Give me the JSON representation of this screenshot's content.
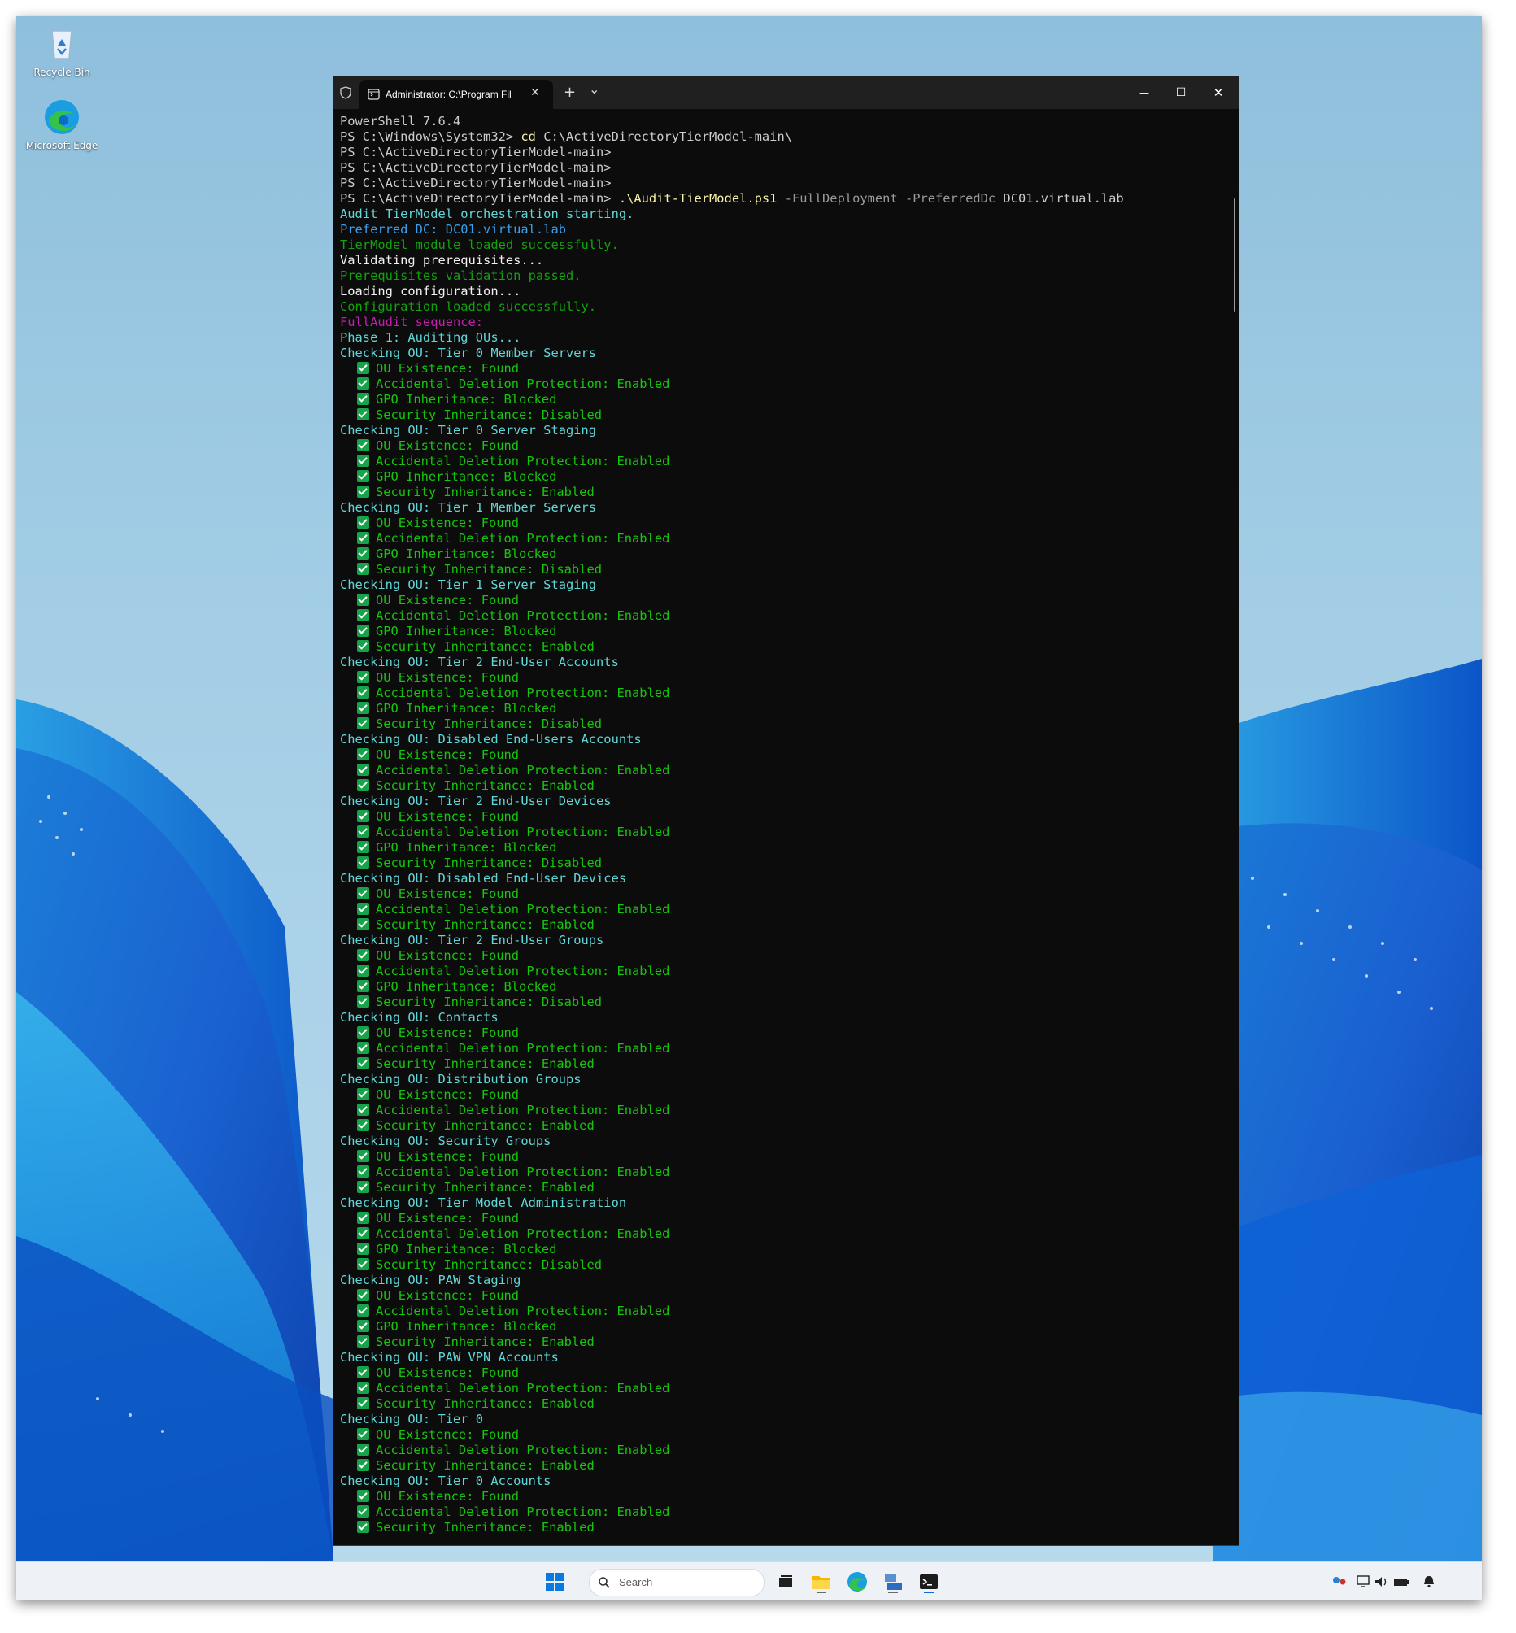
{
  "desktop": {
    "icons": [
      {
        "label": "Recycle Bin",
        "icon": "recycle-bin-icon"
      },
      {
        "label": "Microsoft Edge",
        "icon": "edge-icon"
      }
    ]
  },
  "terminal": {
    "tab_title": "Administrator: C:\\Program Fil",
    "new_tab_symbol": "+",
    "dropdown_symbol": "⌄",
    "minimize_symbol": "—",
    "maximize_symbol": "☐",
    "close_symbol": "✕",
    "header_lines": [
      {
        "segments": [
          {
            "text": "PowerShell 7.6.4",
            "color": "white"
          }
        ]
      },
      {
        "segments": [
          {
            "text": "PS C:\\Windows\\System32> ",
            "color": "white"
          },
          {
            "text": "cd",
            "color": "yellow"
          },
          {
            "text": " C:\\ActiveDirectoryTierModel-main\\",
            "color": "white"
          }
        ]
      },
      {
        "segments": [
          {
            "text": "PS C:\\ActiveDirectoryTierModel-main>",
            "color": "white"
          }
        ]
      },
      {
        "segments": [
          {
            "text": "PS C:\\ActiveDirectoryTierModel-main>",
            "color": "white"
          }
        ]
      },
      {
        "segments": [
          {
            "text": "PS C:\\ActiveDirectoryTierModel-main>",
            "color": "white"
          }
        ]
      },
      {
        "segments": [
          {
            "text": "PS C:\\ActiveDirectoryTierModel-main> ",
            "color": "white"
          },
          {
            "text": ".\\Audit-TierModel.ps1",
            "color": "yellow"
          },
          {
            "text": " -FullDeployment -PreferredDc ",
            "color": "gray"
          },
          {
            "text": "DC01.virtual.lab",
            "color": "white"
          }
        ]
      },
      {
        "segments": [
          {
            "text": "Audit TierModel orchestration starting.",
            "color": "cyan"
          }
        ]
      },
      {
        "segments": [
          {
            "text": "Preferred DC: DC01.virtual.lab",
            "color": "blue"
          }
        ]
      },
      {
        "segments": [
          {
            "text": "TierModel module loaded successfully.",
            "color": "green"
          }
        ]
      },
      {
        "segments": [
          {
            "text": "Validating prerequisites...",
            "color": "bright"
          }
        ]
      },
      {
        "segments": [
          {
            "text": "Prerequisites validation passed.",
            "color": "green"
          }
        ]
      },
      {
        "segments": [
          {
            "text": "Loading configuration...",
            "color": "bright"
          }
        ]
      },
      {
        "segments": [
          {
            "text": "Configuration loaded successfully.",
            "color": "green"
          }
        ]
      },
      {
        "segments": [
          {
            "text": "FullAudit sequence:",
            "color": "magenta"
          }
        ]
      },
      {
        "segments": [
          {
            "text": "Phase 1: Auditing OUs...",
            "color": "cyan"
          }
        ]
      }
    ],
    "ou_checks": [
      {
        "heading": "Checking OU: Tier 0 Member Servers",
        "results": [
          "OU Existence: Found",
          "Accidental Deletion Protection: Enabled",
          "GPO Inheritance: Blocked",
          "Security Inheritance: Disabled"
        ]
      },
      {
        "heading": "Checking OU: Tier 0 Server Staging",
        "results": [
          "OU Existence: Found",
          "Accidental Deletion Protection: Enabled",
          "GPO Inheritance: Blocked",
          "Security Inheritance: Enabled"
        ]
      },
      {
        "heading": "Checking OU: Tier 1 Member Servers",
        "results": [
          "OU Existence: Found",
          "Accidental Deletion Protection: Enabled",
          "GPO Inheritance: Blocked",
          "Security Inheritance: Disabled"
        ]
      },
      {
        "heading": "Checking OU: Tier 1 Server Staging",
        "results": [
          "OU Existence: Found",
          "Accidental Deletion Protection: Enabled",
          "GPO Inheritance: Blocked",
          "Security Inheritance: Enabled"
        ]
      },
      {
        "heading": "Checking OU: Tier 2 End-User Accounts",
        "results": [
          "OU Existence: Found",
          "Accidental Deletion Protection: Enabled",
          "GPO Inheritance: Blocked",
          "Security Inheritance: Disabled"
        ]
      },
      {
        "heading": "Checking OU: Disabled End-Users Accounts",
        "results": [
          "OU Existence: Found",
          "Accidental Deletion Protection: Enabled",
          "Security Inheritance: Enabled"
        ]
      },
      {
        "heading": "Checking OU: Tier 2 End-User Devices",
        "results": [
          "OU Existence: Found",
          "Accidental Deletion Protection: Enabled",
          "GPO Inheritance: Blocked",
          "Security Inheritance: Disabled"
        ]
      },
      {
        "heading": "Checking OU: Disabled End-User Devices",
        "results": [
          "OU Existence: Found",
          "Accidental Deletion Protection: Enabled",
          "Security Inheritance: Enabled"
        ]
      },
      {
        "heading": "Checking OU: Tier 2 End-User Groups",
        "results": [
          "OU Existence: Found",
          "Accidental Deletion Protection: Enabled",
          "GPO Inheritance: Blocked",
          "Security Inheritance: Disabled"
        ]
      },
      {
        "heading": "Checking OU: Contacts",
        "results": [
          "OU Existence: Found",
          "Accidental Deletion Protection: Enabled",
          "Security Inheritance: Enabled"
        ]
      },
      {
        "heading": "Checking OU: Distribution Groups",
        "results": [
          "OU Existence: Found",
          "Accidental Deletion Protection: Enabled",
          "Security Inheritance: Enabled"
        ]
      },
      {
        "heading": "Checking OU: Security Groups",
        "results": [
          "OU Existence: Found",
          "Accidental Deletion Protection: Enabled",
          "Security Inheritance: Enabled"
        ]
      },
      {
        "heading": "Checking OU: Tier Model Administration",
        "results": [
          "OU Existence: Found",
          "Accidental Deletion Protection: Enabled",
          "GPO Inheritance: Blocked",
          "Security Inheritance: Disabled"
        ]
      },
      {
        "heading": "Checking OU: PAW Staging",
        "results": [
          "OU Existence: Found",
          "Accidental Deletion Protection: Enabled",
          "GPO Inheritance: Blocked",
          "Security Inheritance: Enabled"
        ]
      },
      {
        "heading": "Checking OU: PAW VPN Accounts",
        "results": [
          "OU Existence: Found",
          "Accidental Deletion Protection: Enabled",
          "Security Inheritance: Enabled"
        ]
      },
      {
        "heading": "Checking OU: Tier 0",
        "results": [
          "OU Existence: Found",
          "Accidental Deletion Protection: Enabled",
          "Security Inheritance: Enabled"
        ]
      },
      {
        "heading": "Checking OU: Tier 0 Accounts",
        "results": [
          "OU Existence: Found",
          "Accidental Deletion Protection: Enabled",
          "Security Inheritance: Enabled"
        ]
      }
    ]
  },
  "taskbar": {
    "search_placeholder": "Search",
    "items": [
      "start-button",
      "search-box",
      "task-view",
      "file-explorer",
      "microsoft-edge",
      "server-manager",
      "terminal"
    ],
    "tray": [
      "people-icon",
      "network-icon",
      "volume-icon",
      "battery-icon",
      "notification-icon"
    ]
  },
  "colors": {
    "white": "#cccccc",
    "yellow": "#f9f1a5",
    "gray": "#9a9a9a",
    "cyan": "#61d6d6",
    "blue": "#3b9fea",
    "green": "#13a10e",
    "bright": "#f2f2f2",
    "magenta": "#c41fb1",
    "check_green": "#16a34a"
  }
}
